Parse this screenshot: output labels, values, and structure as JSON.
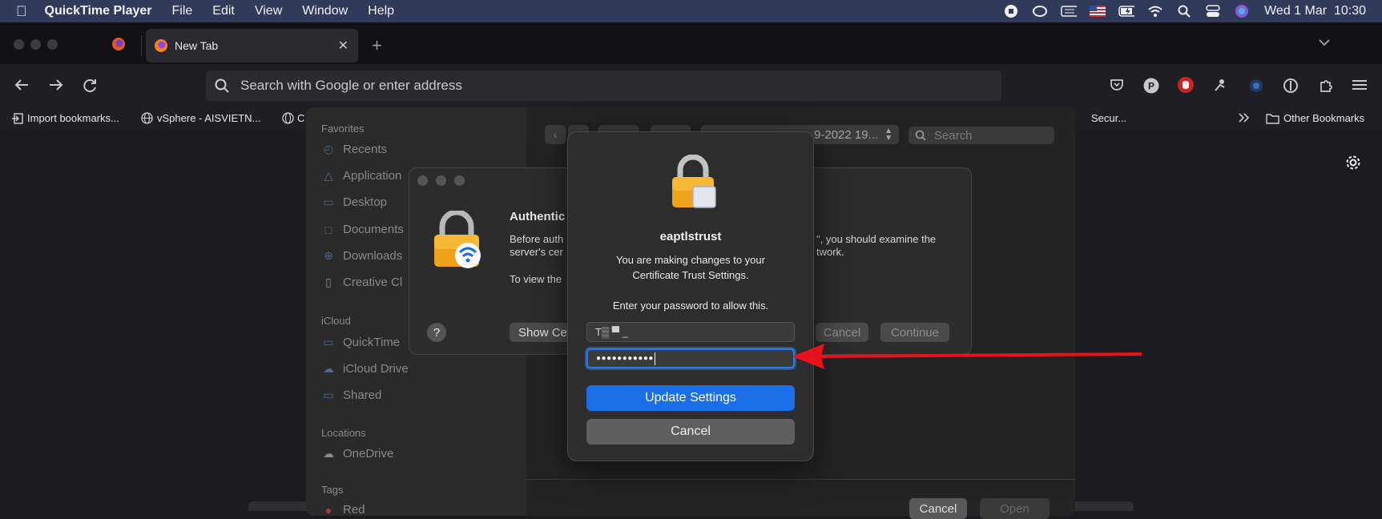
{
  "menubar": {
    "app_name": "QuickTime Player",
    "items": [
      "File",
      "Edit",
      "View",
      "Window",
      "Help"
    ],
    "datetime": "Wed 1 Mar  10:30"
  },
  "browser": {
    "tab_title": "New Tab",
    "url_placeholder": "Search with Google or enter address",
    "bookmarks": [
      "Import bookmarks...",
      "vSphere - AISVIETN...",
      "C"
    ],
    "bookmark_right_partial": "Secur...",
    "other_bookmarks": "Other Bookmarks"
  },
  "finder": {
    "sections": {
      "favorites": "Favorites",
      "icloud": "iCloud",
      "locations": "Locations",
      "tags": "Tags"
    },
    "favorites": [
      "Recents",
      "Application",
      "Desktop",
      "Documents",
      "Downloads",
      "Creative Cl"
    ],
    "icloud_items": [
      "QuickTime",
      "iCloud Drive",
      "Shared"
    ],
    "location_items": [
      "OneDrive"
    ],
    "tags_partial": "Red",
    "path_popup": "9-2022 19...",
    "search_placeholder": "Search",
    "cancel_label": "Cancel",
    "open_label": "Open"
  },
  "auth_dialog": {
    "title": "Authentic",
    "body_line1_left": "Before auth",
    "body_line1_right": "\", you should examine the",
    "body_line2_left": "server's cer",
    "body_line2_right": "twork.",
    "body_line3": "To view the",
    "help_label": "?",
    "show_cert_label": "Show Ce",
    "cancel_label": "Cancel",
    "continue_label": "Continue"
  },
  "password_sheet": {
    "title": "eaptlstrust",
    "message_line1": "You are making changes to your",
    "message_line2": "Certificate Trust Settings.",
    "prompt": "Enter your password to allow this.",
    "username_value": "T▒ ▀ _",
    "password_value": "●●●●●●●●●●●",
    "update_label": "Update Settings",
    "cancel_label": "Cancel"
  },
  "colors": {
    "accent_blue": "#1a6fe8",
    "annotation_red": "#e8121b",
    "focus_ring": "#2d7be3"
  }
}
